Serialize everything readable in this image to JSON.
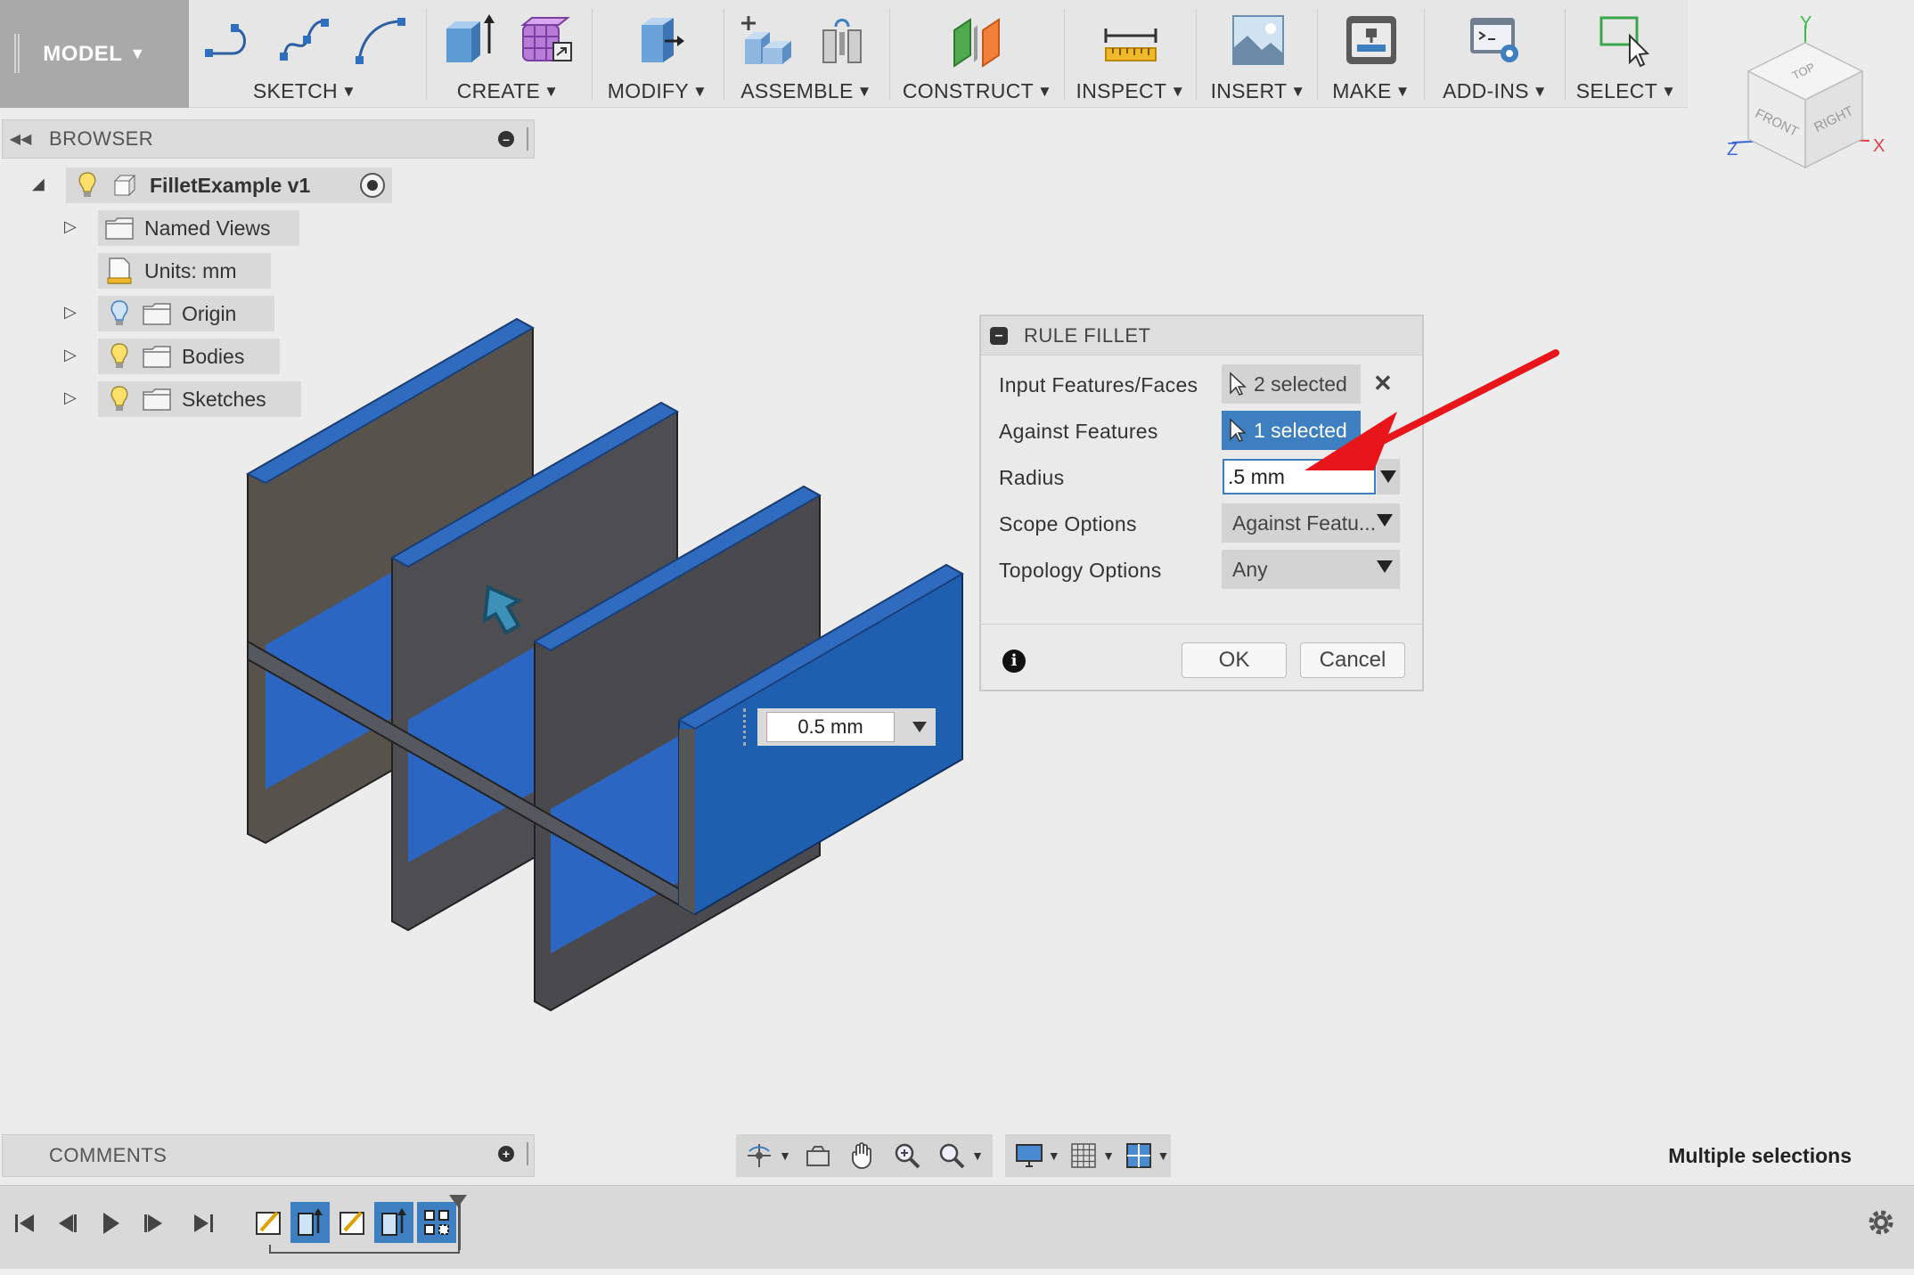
{
  "toolbar": {
    "workspace": "MODEL",
    "groups": [
      {
        "label": "SKETCH"
      },
      {
        "label": "CREATE"
      },
      {
        "label": "MODIFY"
      },
      {
        "label": "ASSEMBLE"
      },
      {
        "label": "CONSTRUCT"
      },
      {
        "label": "INSPECT"
      },
      {
        "label": "INSERT"
      },
      {
        "label": "MAKE"
      },
      {
        "label": "ADD-INS"
      },
      {
        "label": "SELECT"
      }
    ]
  },
  "viewcube": {
    "faces": {
      "top": "TOP",
      "front": "FRONT",
      "right": "RIGHT"
    },
    "axes": {
      "x": "X",
      "y": "Y",
      "z": "Z"
    }
  },
  "browser": {
    "title": "BROWSER",
    "root": "FilletExample v1",
    "items": [
      {
        "label": "Named Views",
        "icon": "folder-icon"
      },
      {
        "label": "Units: mm",
        "icon": "document-icon"
      },
      {
        "label": "Origin",
        "icon": "folder-icon"
      },
      {
        "label": "Bodies",
        "icon": "folder-icon"
      },
      {
        "label": "Sketches",
        "icon": "folder-icon"
      }
    ]
  },
  "dialog": {
    "title": "RULE FILLET",
    "rows": [
      {
        "label": "Input Features/Faces",
        "value": "2 selected"
      },
      {
        "label": "Against Features",
        "value": "1 selected"
      },
      {
        "label": "Radius",
        "value": ".5 mm"
      },
      {
        "label": "Scope Options",
        "value": "Against Featu..."
      },
      {
        "label": "Topology Options",
        "value": "Any"
      }
    ],
    "ok": "OK",
    "cancel": "Cancel"
  },
  "viewport": {
    "radius_callout": "0.5 mm"
  },
  "comments": {
    "title": "COMMENTS"
  },
  "status": "Multiple selections",
  "colors": {
    "accent": "#3d7fc1",
    "body_blue": "#1f5fb0",
    "wall_gray": "#4a4a4e",
    "annotation_arrow": "#e8151b"
  }
}
